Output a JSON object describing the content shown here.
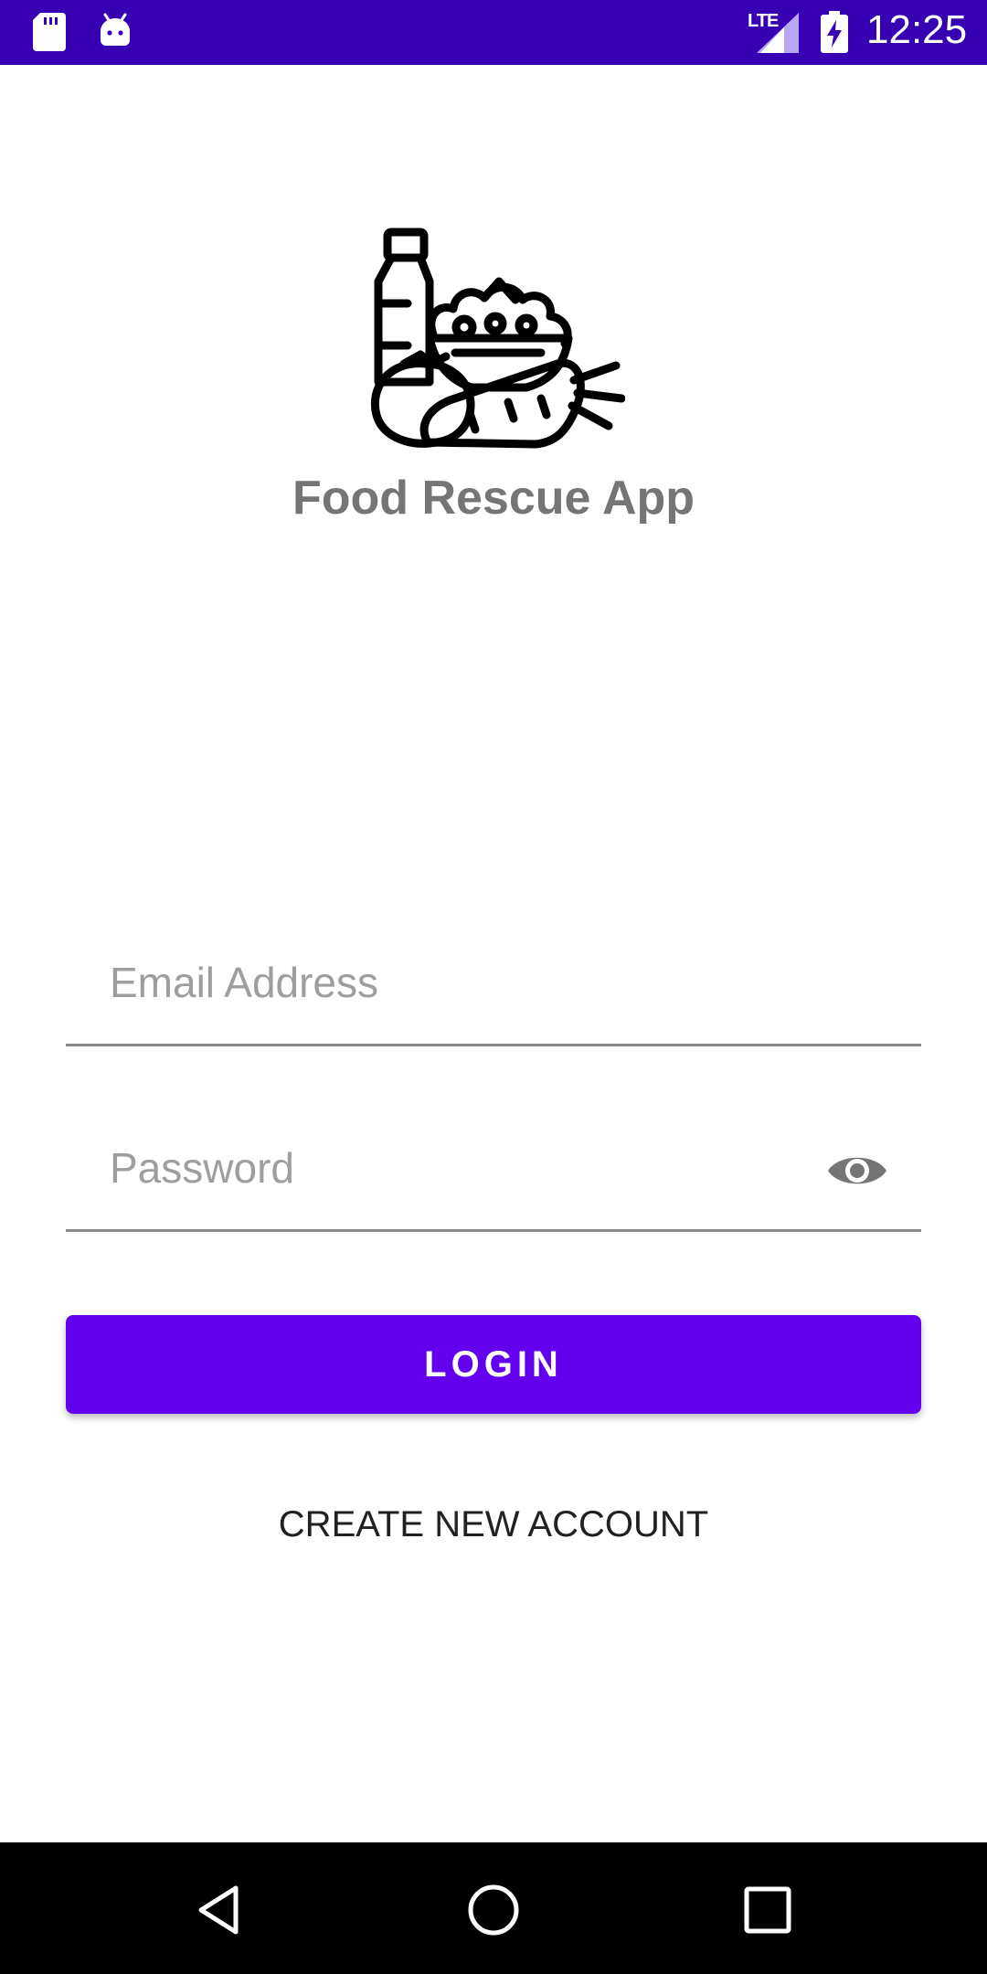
{
  "status_bar": {
    "network_label": "LTE",
    "time": "12:25",
    "icons": [
      "sd-card-icon",
      "android-icon",
      "signal-icon",
      "battery-charging-icon"
    ]
  },
  "header": {
    "app_title": "Food Rescue App",
    "logo_icon": "groceries-logo-icon"
  },
  "form": {
    "email_placeholder": "Email Address",
    "email_value": "",
    "password_placeholder": "Password",
    "password_value": "",
    "password_toggle_icon": "eye-icon",
    "login_label": "LOGIN",
    "create_account_label": "CREATE NEW ACCOUNT"
  },
  "nav_bar": {
    "icons": [
      "back-icon",
      "home-icon",
      "recents-icon"
    ]
  },
  "colors": {
    "status_bar": "#3700b3",
    "primary": "#6200ee",
    "title_text": "#757575",
    "placeholder": "#9e9e9e",
    "nav_bar": "#000000"
  }
}
